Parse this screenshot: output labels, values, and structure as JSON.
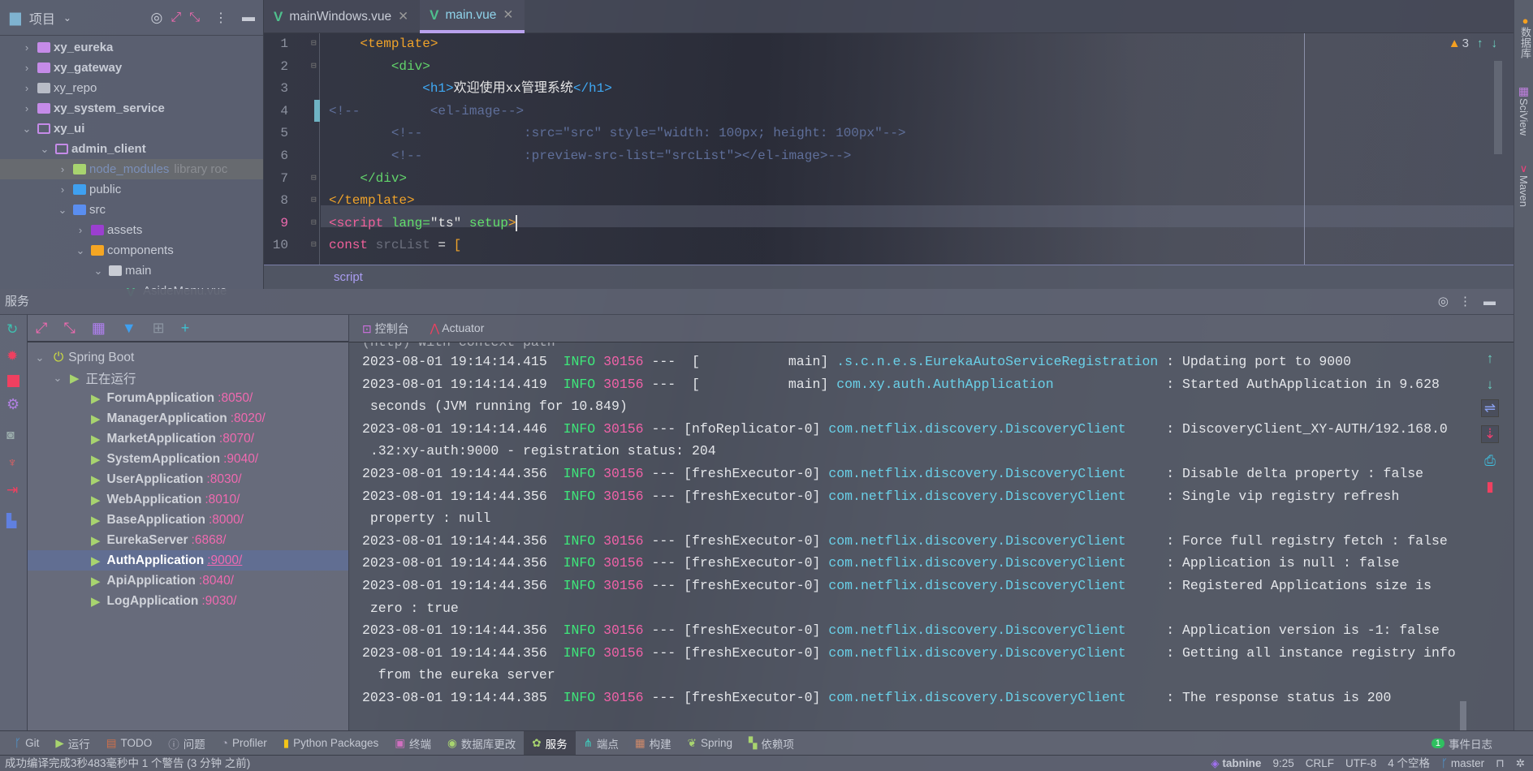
{
  "project": {
    "title": "项目",
    "tree": [
      {
        "label": "xy_eureka",
        "depth": 0,
        "open": false,
        "color": "#c58be8",
        "bold": true
      },
      {
        "label": "xy_gateway",
        "depth": 0,
        "open": false,
        "color": "#c58be8",
        "bold": true
      },
      {
        "label": "xy_repo",
        "depth": 0,
        "open": false,
        "color": "#b8bcc6",
        "bold": false
      },
      {
        "label": "xy_system_service",
        "depth": 0,
        "open": false,
        "color": "#c58be8",
        "bold": true
      },
      {
        "label": "xy_ui",
        "depth": 0,
        "open": true,
        "color": "#c58be8",
        "bold": true
      },
      {
        "label": "admin_client",
        "depth": 1,
        "open": true,
        "color": "#c58be8",
        "bold": true
      },
      {
        "label": "node_modules",
        "suffix": "library roc",
        "depth": 2,
        "open": false,
        "color": "#a8d46f",
        "dim": true
      },
      {
        "label": "public",
        "depth": 2,
        "open": false,
        "color": "#3fa0f0"
      },
      {
        "label": "src",
        "depth": 2,
        "open": true,
        "color": "#5a8ef0"
      },
      {
        "label": "assets",
        "depth": 3,
        "open": false,
        "color": "#9b3fd0"
      },
      {
        "label": "components",
        "depth": 3,
        "open": true,
        "color": "#f5a623"
      },
      {
        "label": "main",
        "depth": 4,
        "open": true,
        "color": "#c9ccd4"
      },
      {
        "label": "AsideMenu.vue",
        "depth": 5,
        "leaf": true,
        "color": "#4fc08d"
      }
    ]
  },
  "editor": {
    "tabs": [
      {
        "label": "mainWindows.vue",
        "active": false
      },
      {
        "label": "main.vue",
        "active": true
      }
    ],
    "warnings": "3",
    "breadcrumb": "script",
    "lines": [
      [
        [
          "    ",
          ""
        ],
        [
          "<template>",
          "t-tag"
        ]
      ],
      [
        [
          "    ",
          ""
        ],
        [
          "    ",
          ""
        ],
        [
          "<div>",
          "t-el"
        ]
      ],
      [
        [
          "            ",
          ""
        ],
        [
          "<h1>",
          "t-h1"
        ],
        [
          "欢迎使用xx管理系统",
          "t-txt"
        ],
        [
          "</h1>",
          "t-h1"
        ]
      ],
      [
        [
          "<!--         ",
          "t-cm"
        ],
        [
          "<el-image-->",
          "t-cm"
        ]
      ],
      [
        [
          "        <!--             :src=\"src\" style=\"width: 100px; height: 100px\"-->",
          "t-cm"
        ]
      ],
      [
        [
          "        <!--             :preview-src-list=\"srcList\"></el-image>-->",
          "t-cm"
        ]
      ],
      [
        [
          "    ",
          ""
        ],
        [
          "</div>",
          "t-el"
        ]
      ],
      [
        [
          "</template>",
          "t-tag"
        ]
      ],
      [
        [
          "<script ",
          "t-kw"
        ],
        [
          "lang=",
          "t-attr"
        ],
        [
          "\"ts\" ",
          "t-str"
        ],
        [
          "setup",
          "t-attr"
        ],
        [
          ">",
          "t-tag"
        ]
      ],
      [
        [
          "const ",
          "t-kw"
        ],
        [
          "srcList",
          "t-dim"
        ],
        [
          " = ",
          "t-txt"
        ],
        [
          "[",
          "t-tag"
        ]
      ]
    ]
  },
  "right_strip": [
    "数据库",
    "SciView",
    "Maven"
  ],
  "services": {
    "title": "服务",
    "root": "Spring Boot",
    "group": "正在运行",
    "apps": [
      {
        "name": "ForumApplication",
        "port": ":8050/"
      },
      {
        "name": "ManagerApplication",
        "port": ":8020/"
      },
      {
        "name": "MarketApplication",
        "port": ":8070/"
      },
      {
        "name": "SystemApplication",
        "port": ":9040/"
      },
      {
        "name": "UserApplication",
        "port": ":8030/"
      },
      {
        "name": "WebApplication",
        "port": ":8010/"
      },
      {
        "name": "BaseApplication",
        "port": ":8000/"
      },
      {
        "name": "EurekaServer",
        "port": ":6868/"
      },
      {
        "name": "AuthApplication",
        "port": ":9000/",
        "selected": true
      },
      {
        "name": "ApiApplication",
        "port": ":8040/"
      },
      {
        "name": "LogApplication",
        "port": ":9030/"
      }
    ]
  },
  "console": {
    "tabs": [
      "控制台",
      "Actuator"
    ],
    "lines": [
      {
        "ts": "2023-08-01 19:14:14.415",
        "level": "INFO",
        "pid": "30156",
        "thread": "---  [           main]",
        "logger": ".s.c.n.e.s.EurekaAutoServiceRegistration",
        "msg": " : Updating port to 9000"
      },
      {
        "ts": "2023-08-01 19:14:14.419",
        "level": "INFO",
        "pid": "30156",
        "thread": "---  [           main]",
        "logger": "com.xy.auth.AuthApplication             ",
        "msg": " : Started AuthApplication in 9.628"
      },
      {
        "cont": " seconds (JVM running for 10.849)"
      },
      {
        "ts": "2023-08-01 19:14:14.446",
        "level": "INFO",
        "pid": "30156",
        "thread": "--- [nfoReplicator-0]",
        "logger": "com.netflix.discovery.DiscoveryClient    ",
        "msg": " : DiscoveryClient_XY-AUTH/192.168.0"
      },
      {
        "cont": " .32:xy-auth:9000 - registration status: 204"
      },
      {
        "ts": "2023-08-01 19:14:44.356",
        "level": "INFO",
        "pid": "30156",
        "thread": "--- [freshExecutor-0]",
        "logger": "com.netflix.discovery.DiscoveryClient    ",
        "msg": " : Disable delta property : false"
      },
      {
        "ts": "2023-08-01 19:14:44.356",
        "level": "INFO",
        "pid": "30156",
        "thread": "--- [freshExecutor-0]",
        "logger": "com.netflix.discovery.DiscoveryClient    ",
        "msg": " : Single vip registry refresh"
      },
      {
        "cont": " property : null"
      },
      {
        "ts": "2023-08-01 19:14:44.356",
        "level": "INFO",
        "pid": "30156",
        "thread": "--- [freshExecutor-0]",
        "logger": "com.netflix.discovery.DiscoveryClient    ",
        "msg": " : Force full registry fetch : false"
      },
      {
        "ts": "2023-08-01 19:14:44.356",
        "level": "INFO",
        "pid": "30156",
        "thread": "--- [freshExecutor-0]",
        "logger": "com.netflix.discovery.DiscoveryClient    ",
        "msg": " : Application is null : false"
      },
      {
        "ts": "2023-08-01 19:14:44.356",
        "level": "INFO",
        "pid": "30156",
        "thread": "--- [freshExecutor-0]",
        "logger": "com.netflix.discovery.DiscoveryClient    ",
        "msg": " : Registered Applications size is"
      },
      {
        "cont": " zero : true"
      },
      {
        "ts": "2023-08-01 19:14:44.356",
        "level": "INFO",
        "pid": "30156",
        "thread": "--- [freshExecutor-0]",
        "logger": "com.netflix.discovery.DiscoveryClient    ",
        "msg": " : Application version is -1: false"
      },
      {
        "ts": "2023-08-01 19:14:44.356",
        "level": "INFO",
        "pid": "30156",
        "thread": "--- [freshExecutor-0]",
        "logger": "com.netflix.discovery.DiscoveryClient    ",
        "msg": " : Getting all instance registry info"
      },
      {
        "cont": "  from the eureka server"
      },
      {
        "ts": "2023-08-01 19:14:44.385",
        "level": "INFO",
        "pid": "30156",
        "thread": "--- [freshExecutor-0]",
        "logger": "com.netflix.discovery.DiscoveryClient    ",
        "msg": " : The response status is 200"
      }
    ]
  },
  "toolwindows": [
    {
      "label": "Git",
      "icon": "git-icon",
      "glyph": "ᚴ",
      "color": "#4aa3e8"
    },
    {
      "label": "运行",
      "icon": "run-icon",
      "glyph": "▶",
      "color": "#a8d46f"
    },
    {
      "label": "TODO",
      "icon": "todo-icon",
      "glyph": "▤",
      "color": "#d0704a"
    },
    {
      "label": "问题",
      "icon": "problems-icon",
      "glyph": "ⓘ",
      "color": "#aab"
    },
    {
      "label": "Profiler",
      "icon": "profiler-icon",
      "glyph": "◔",
      "color": "#aab"
    },
    {
      "label": "Python Packages",
      "icon": "python-packages-icon",
      "glyph": "▮",
      "color": "#f5c518"
    },
    {
      "label": "终端",
      "icon": "terminal-icon",
      "glyph": "▣",
      "color": "#d070c0"
    },
    {
      "label": "数据库更改",
      "icon": "database-changes-icon",
      "glyph": "◉",
      "color": "#a8d46f"
    },
    {
      "label": "服务",
      "icon": "services-icon",
      "glyph": "✿",
      "color": "#a8d46f",
      "active": true
    },
    {
      "label": "端点",
      "icon": "endpoints-icon",
      "glyph": "⋔",
      "color": "#3fd0c0"
    },
    {
      "label": "构建",
      "icon": "build-icon",
      "glyph": "▦",
      "color": "#d08a6a"
    },
    {
      "label": "Spring",
      "icon": "spring-icon",
      "glyph": "❦",
      "color": "#a8d46f"
    },
    {
      "label": "依赖项",
      "icon": "dependencies-icon",
      "glyph": "▚",
      "color": "#a8d46f"
    }
  ],
  "event_log": {
    "label": "事件日志",
    "count": "1"
  },
  "status": {
    "message": "成功编译完成3秒483毫秒中 1 个警告 (3 分钟 之前)",
    "tabnine": "tabnine",
    "position": "9:25",
    "line_sep": "CRLF",
    "encoding": "UTF-8",
    "indent": "4 个空格",
    "branch": "master"
  },
  "colors": {
    "accent": "#b9a2ee",
    "info": "#3ee77a",
    "pid": "#f062a8",
    "logger": "#6ad0e8",
    "port": "#f06ab0"
  }
}
